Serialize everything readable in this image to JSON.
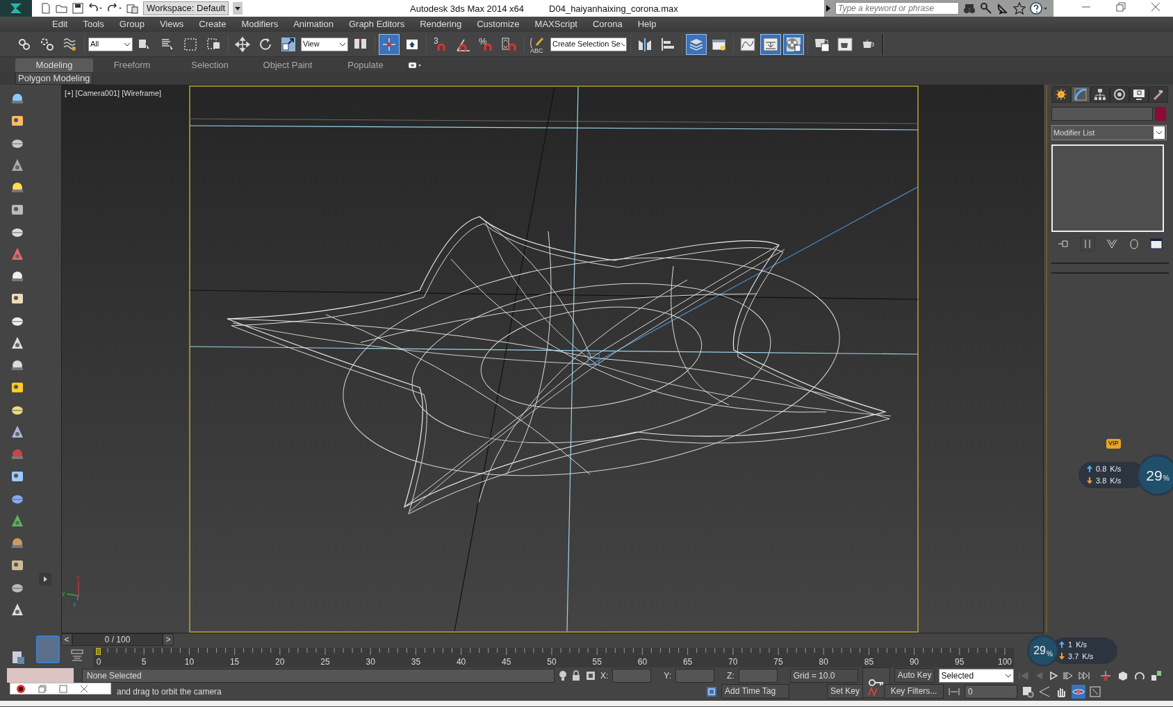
{
  "window": {
    "app_title": "Autodesk 3ds Max  2014 x64",
    "file_name": "D04_haiyanhaixing_corona.max"
  },
  "workspace": "Workspace: Default",
  "search": {
    "placeholder": "Type a keyword or phrase"
  },
  "menu": [
    "Edit",
    "Tools",
    "Group",
    "Views",
    "Create",
    "Modifiers",
    "Animation",
    "Graph Editors",
    "Rendering",
    "Customize",
    "MAXScript",
    "Corona",
    "Help"
  ],
  "toolbar": {
    "selection_filter": "All",
    "reference_coordinate": "View",
    "snap_label": "3",
    "percent_snap_label": "%",
    "named_sets_label": "ABC",
    "named_selection_set": "Create Selection Se",
    "buttons": [
      {
        "on": false
      },
      {
        "on": false
      },
      {
        "on": false
      },
      {
        "on": false
      },
      {
        "on": false
      },
      {
        "on": false
      },
      {
        "on": false
      },
      {
        "on": false
      },
      {
        "on": false
      },
      {
        "on": false
      },
      {
        "on": false
      },
      {
        "on": true
      },
      {
        "on": false
      },
      {
        "on": false
      },
      {
        "on": false
      },
      {
        "on": false
      },
      {
        "on": false
      },
      {
        "on": false
      },
      {
        "on": false
      },
      {
        "on": false
      },
      {
        "on": true
      },
      {
        "on": false
      },
      {
        "on": false
      },
      {
        "on": true
      },
      {
        "on": true
      },
      {
        "on": false
      },
      {
        "on": false
      },
      {
        "on": false
      }
    ]
  },
  "ribbon": {
    "tabs": [
      {
        "label": "Modeling",
        "selected": true
      },
      {
        "label": "Freeform",
        "selected": false
      },
      {
        "label": "Selection",
        "selected": false
      },
      {
        "label": "Object Paint",
        "selected": false
      },
      {
        "label": "Populate",
        "selected": false
      }
    ],
    "panel": "Polygon Modeling"
  },
  "viewport": {
    "label": "[+] [Camera001] [Wireframe]",
    "axis_labels": [
      "z",
      "y",
      "x"
    ]
  },
  "command_panel": {
    "tabs": [
      {
        "selected": false
      },
      {
        "selected": true
      },
      {
        "selected": false
      },
      {
        "selected": false
      },
      {
        "selected": false
      },
      {
        "selected": false
      }
    ],
    "modifier_list": "Modifier List"
  },
  "timeline": {
    "frame": "0 / 100",
    "level": 0,
    "prev": "<",
    "next": ">",
    "ticks": [
      "0",
      "5",
      "10",
      "15",
      "20",
      "25",
      "30",
      "35",
      "40",
      "45",
      "50",
      "55",
      "60",
      "65",
      "70",
      "75",
      "80",
      "85",
      "90",
      "95",
      "100"
    ]
  },
  "status": {
    "selection": "None Selected",
    "prompt": "and drag to orbit the camera",
    "x_label": "X:",
    "y_label": "Y:",
    "z_label": "Z:",
    "grid": "Grid = 10.0",
    "add_time_tag": "Add Time Tag"
  },
  "animation": {
    "auto_key": "Auto Key",
    "set_key": "Set Key",
    "key_mode": "Selected",
    "key_filters": "Key Filters...",
    "current_frame": "0"
  },
  "net_monitors": [
    {
      "badge": "VIP",
      "up": "0.8",
      "up_unit": "K/s",
      "down": "3.8",
      "down_unit": "K/s",
      "percent": "29",
      "percent_unit": "%"
    },
    {
      "up": "1",
      "up_unit": "K/s",
      "down": "3.7",
      "down_unit": "K/s",
      "percent": "29",
      "percent_unit": "%"
    }
  ]
}
